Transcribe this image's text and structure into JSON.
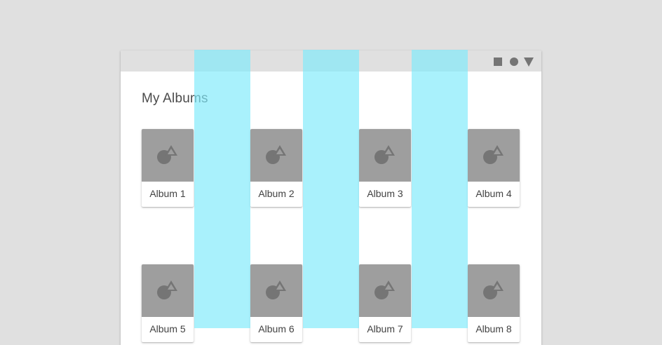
{
  "status_bar": {
    "icons": [
      "square-icon",
      "circle-icon",
      "triangle-icon"
    ]
  },
  "screen": {
    "title": "My Albums"
  },
  "albums": [
    {
      "label": "Album 1"
    },
    {
      "label": "Album 2"
    },
    {
      "label": "Album 3"
    },
    {
      "label": "Album 4"
    },
    {
      "label": "Album 5"
    },
    {
      "label": "Album 6"
    },
    {
      "label": "Album 7"
    },
    {
      "label": "Album 8"
    }
  ],
  "colors": {
    "background": "#e0e0e0",
    "status_bar": "#e0e0e0",
    "thumbnail": "#9e9e9e",
    "thumbnail_icon": "#757575",
    "gutter_overlay": "#80eafa",
    "text": "#424242"
  }
}
